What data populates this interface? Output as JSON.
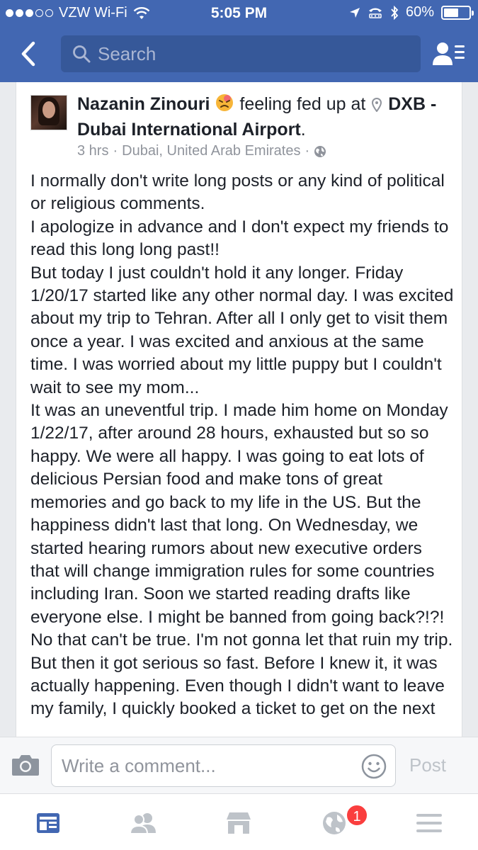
{
  "status_bar": {
    "carrier": "VZW Wi-Fi",
    "time": "5:05 PM",
    "battery": "60%",
    "battery_level": 0.6
  },
  "nav": {
    "search_placeholder": "Search",
    "back_icon": "chevron-left-icon",
    "friends_icon": "friend-list-icon"
  },
  "post": {
    "author": "Nazanin Zinouri",
    "feeling": "feeling fed up at",
    "place": "DXB - Dubai International Airport",
    "place_suffix": ".",
    "time": "3 hrs",
    "location": "Dubai, United Arab Emirates",
    "separator": "·",
    "body": [
      "I normally don't write long posts or any kind of political or religious comments.",
      "I apologize in advance and I don't expect my friends to read this long long past!!",
      "But today I just couldn't hold it any longer. Friday 1/20/17 started like any other normal day. I was excited about my trip to Tehran. After all I only get to visit them once a year. I was excited and anxious at the same time. I was worried about my little puppy but I couldn't wait to see my mom...",
      "It was an uneventful trip. I made him home on Monday 1/22/17, after around 28 hours, exhausted but so so happy. We were all happy. I was going to eat lots of delicious Persian food and make tons of great memories and go back to my life in the US. But the happiness didn't last that long. On Wednesday, we started hearing rumors about new executive orders that will change immigration rules for some countries including Iran. Soon we started reading drafts like everyone else. I might be banned from going back?!?! No that can't be true. I'm not gonna let that ruin my trip. But then it got serious so fast. Before I knew it, it was actually happening. Even though I didn't want to leave my family, I quickly booked a ticket to get on the next"
    ]
  },
  "comment_bar": {
    "placeholder": "Write a comment...",
    "post_label": "Post"
  },
  "tab_bar": {
    "notifications_badge": "1"
  },
  "colors": {
    "brand": "#4267b2",
    "search_bg": "#365899",
    "active_tab": "#4267b2",
    "badge": "#fa3e3e"
  }
}
